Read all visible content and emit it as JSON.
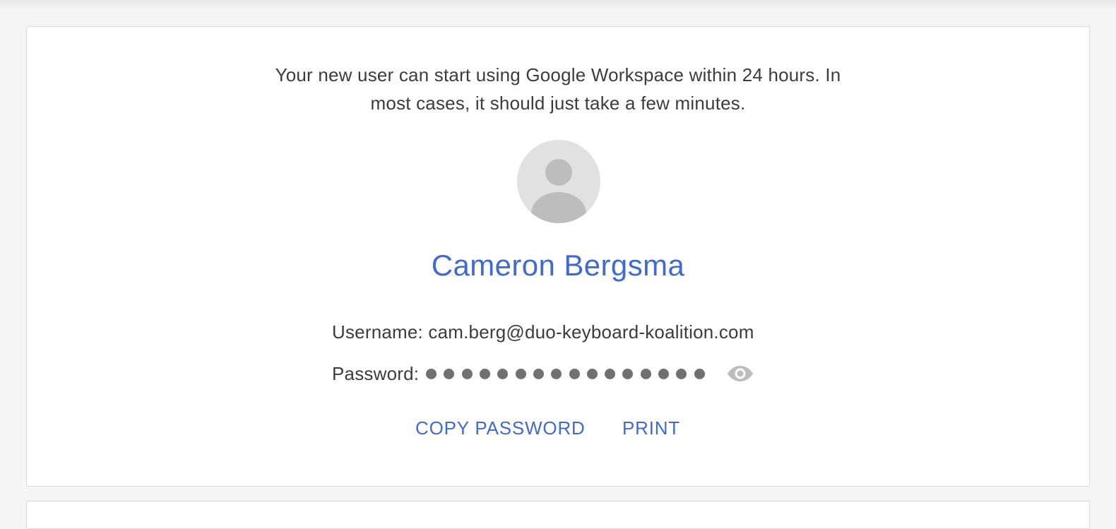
{
  "message": {
    "line1": "Your new user can start using Google Workspace within 24 hours. In",
    "line2": "most cases, it should just take a few minutes."
  },
  "user": {
    "avatar_icon": "default-person-avatar",
    "name": "Cameron Bergsma",
    "username_label": "Username:",
    "username": "cam.berg@duo-keyboard-koalition.com",
    "password_label": "Password:",
    "password_masked_length": 16,
    "show_password_icon": "eye-icon"
  },
  "actions": {
    "copy_password": "COPY PASSWORD",
    "print": "PRINT"
  },
  "colors": {
    "accent": "#3f6bd0",
    "text": "#3c3c3c",
    "avatar_bg": "#e1e1e1",
    "avatar_fg": "#bdbdbd",
    "password_dot": "#707070",
    "eye_icon": "#bdbdbd"
  }
}
